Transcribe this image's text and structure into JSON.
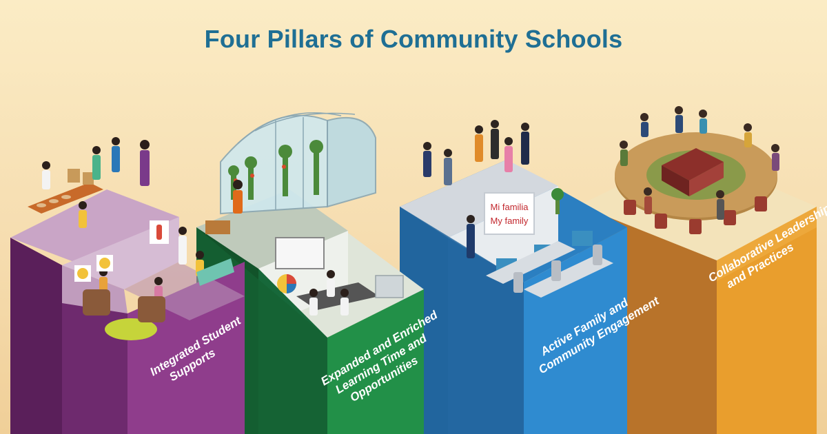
{
  "title": "Four Pillars of Community Schools",
  "colors": {
    "background": "#f8e3b8",
    "title": "#1f6f94",
    "pillar_1": "#8a3a86",
    "pillar_2": "#1e7a3a",
    "pillar_3": "#2a78b8",
    "pillar_4": "#e89a2c"
  },
  "pillars": [
    {
      "label_lines": [
        "Integrated Student",
        "Supports"
      ],
      "icon": "health-office-scene"
    },
    {
      "label_lines": [
        "Expanded and Enriched",
        "Learning Time and",
        "Opportunities"
      ],
      "icon": "greenhouse-lab-scene"
    },
    {
      "label_lines": [
        "Active Family and",
        "Community Engagement"
      ],
      "icon": "family-computer-lab-scene"
    },
    {
      "label_lines": [
        "Collaborative Leadership",
        "and Practices"
      ],
      "icon": "roundtable-meeting-scene"
    }
  ],
  "sign": {
    "line1": "Mi familia",
    "line2": "My family"
  }
}
